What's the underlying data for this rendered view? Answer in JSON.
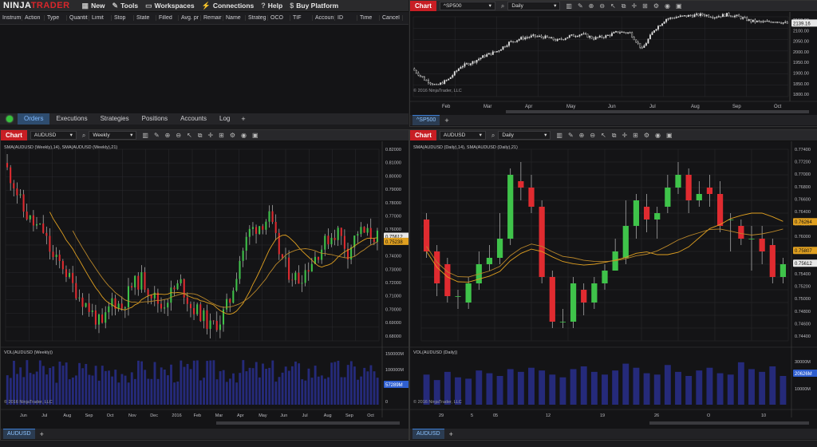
{
  "menu": {
    "logo_a": "NINJA",
    "logo_b": "TRADER",
    "items": [
      {
        "label": "New",
        "icon": "grid-icon"
      },
      {
        "label": "Tools",
        "icon": "wrench-icon"
      },
      {
        "label": "Workspaces",
        "icon": "folder-icon"
      },
      {
        "label": "Connections",
        "icon": "plug-icon"
      },
      {
        "label": "Help",
        "icon": "help-icon"
      },
      {
        "label": "Buy Platform",
        "icon": "dollar-icon"
      }
    ]
  },
  "orders": {
    "columns": [
      "Instrum",
      "Action",
      "Type",
      "Quantit",
      "Limit",
      "Stop",
      "State",
      "Filled",
      "Avg. pr",
      "Remair",
      "Name",
      "Strateg",
      "OCO",
      "TIF",
      "Accoun",
      "ID",
      "Time",
      "Cancel"
    ],
    "tabs": [
      "Orders",
      "Executions",
      "Strategies",
      "Positions",
      "Accounts",
      "Log"
    ],
    "active_tab": "Orders"
  },
  "chart_label": "Chart",
  "charts": [
    {
      "id": "spx",
      "instrument": "^SP500",
      "period": "Daily",
      "tab": "^SP500",
      "copyright": "© 2016 NinjaTrader, LLC",
      "price_labels": [
        "2150.00",
        "2100.00",
        "2050.00",
        "2000.00",
        "1950.00",
        "1900.00",
        "1850.00",
        "1800.00"
      ],
      "current_price": "2139.16",
      "x_labels": [
        "Feb",
        "Mar",
        "Apr",
        "May",
        "Jun",
        "Jul",
        "Aug",
        "Sep",
        "Oct"
      ]
    },
    {
      "id": "aud-weekly",
      "instrument": "AUDUSD",
      "period": "Weekly",
      "tab": "AUDUSD",
      "indicator_label": "SMA(AUDUSD (Weekly),14), SMA(AUDUSD (Weekly),21)",
      "volume_label": "VOL(AUDUSD (Weekly))",
      "copyright": "© 2016 NinjaTrader, LLC",
      "price_labels": [
        "0.82000",
        "0.81000",
        "0.80000",
        "0.79000",
        "0.78000",
        "0.77000",
        "0.76000",
        "0.75000",
        "0.74000",
        "0.73000",
        "0.72000",
        "0.71000",
        "0.70000",
        "0.69000",
        "0.68000"
      ],
      "current_price": "0.75612",
      "sma_price": "0.75238",
      "vol_labels": [
        "150000M",
        "100000M",
        "50000M",
        "0"
      ],
      "current_vol": "57289M",
      "x_labels": [
        "Jun",
        "Jul",
        "Aug",
        "Sep",
        "Oct",
        "Nov",
        "Dec",
        "2016",
        "Feb",
        "Mar",
        "Apr",
        "May",
        "Jun",
        "Jul",
        "Aug",
        "Sep",
        "Oct"
      ]
    },
    {
      "id": "aud-daily",
      "instrument": "AUDUSD",
      "period": "Daily",
      "indicator_label": "SMA(AUDUSD (Daily),14), SMA(AUDUSD (Daily),21)",
      "volume_label": "VOL(AUDUSD (Daily))",
      "copyright": "© 2016 NinjaTrader, LLC",
      "price_labels": [
        "0.77400",
        "0.77200",
        "0.77000",
        "0.76800",
        "0.76600",
        "0.76400",
        "0.76200",
        "0.76000",
        "0.75800",
        "0.75600",
        "0.75400",
        "0.75200",
        "0.75000",
        "0.74800",
        "0.74600",
        "0.74400"
      ],
      "current_price": "0.75612",
      "sma_fast_price": "0.76264",
      "sma_slow_price": "0.75807",
      "vol_labels": [
        "30000M",
        "20000M",
        "10000M"
      ],
      "current_vol": "20626M",
      "x_labels": [
        "29",
        "5",
        "05",
        "12",
        "19",
        "26",
        "O",
        "10"
      ]
    }
  ],
  "chart_data": [
    {
      "type": "candlestick",
      "name": "^SP500 Daily",
      "ylim": [
        1800,
        2160
      ],
      "path": [
        1930,
        1880,
        1850,
        1880,
        1940,
        1960,
        1990,
        2010,
        2050,
        2070,
        2080,
        2075,
        2060,
        2080,
        2090,
        2070,
        2080,
        2100,
        2095,
        2020,
        2110,
        2160,
        2170,
        2175,
        2180,
        2170,
        2180,
        2170,
        2150,
        2145,
        2150,
        2139
      ]
    },
    {
      "type": "candlestick",
      "name": "AUDUSD Weekly",
      "ylim": [
        0.68,
        0.82
      ],
      "path": [
        0.81,
        0.795,
        0.775,
        0.765,
        0.76,
        0.74,
        0.735,
        0.72,
        0.71,
        0.7,
        0.69,
        0.71,
        0.705,
        0.72,
        0.725,
        0.715,
        0.705,
        0.715,
        0.722,
        0.705,
        0.7,
        0.69,
        0.695,
        0.71,
        0.74,
        0.76,
        0.765,
        0.77,
        0.745,
        0.73,
        0.725,
        0.735,
        0.745,
        0.755,
        0.76,
        0.745,
        0.76,
        0.758,
        0.756
      ],
      "sma_fast_last": 0.7524,
      "sma_slow_last": 0.749
    },
    {
      "type": "candlestick",
      "name": "AUDUSD Daily",
      "ylim": [
        0.744,
        0.774
      ],
      "candles": [
        [
          0.763,
          0.758,
          0.764,
          0.757
        ],
        [
          0.758,
          0.753,
          0.759,
          0.751
        ],
        [
          0.756,
          0.751,
          0.757,
          0.75
        ],
        [
          0.751,
          0.751,
          0.752,
          0.749
        ],
        [
          0.75,
          0.753,
          0.754,
          0.749
        ],
        [
          0.753,
          0.756,
          0.758,
          0.752
        ],
        [
          0.756,
          0.757,
          0.759,
          0.755
        ],
        [
          0.757,
          0.76,
          0.764,
          0.756
        ],
        [
          0.76,
          0.77,
          0.771,
          0.759
        ],
        [
          0.769,
          0.768,
          0.772,
          0.766
        ],
        [
          0.768,
          0.765,
          0.77,
          0.764
        ],
        [
          0.765,
          0.754,
          0.766,
          0.753
        ],
        [
          0.754,
          0.747,
          0.755,
          0.746
        ],
        [
          0.747,
          0.747,
          0.749,
          0.746
        ],
        [
          0.747,
          0.753,
          0.754,
          0.746
        ],
        [
          0.752,
          0.75,
          0.753,
          0.748
        ],
        [
          0.75,
          0.753,
          0.754,
          0.749
        ],
        [
          0.753,
          0.755,
          0.756,
          0.752
        ],
        [
          0.755,
          0.758,
          0.76,
          0.755
        ],
        [
          0.757,
          0.762,
          0.766,
          0.756
        ],
        [
          0.762,
          0.766,
          0.767,
          0.76
        ],
        [
          0.765,
          0.763,
          0.767,
          0.761
        ],
        [
          0.763,
          0.764,
          0.765,
          0.76
        ],
        [
          0.765,
          0.768,
          0.77,
          0.764
        ],
        [
          0.768,
          0.77,
          0.772,
          0.767
        ],
        [
          0.77,
          0.766,
          0.771,
          0.764
        ],
        [
          0.766,
          0.767,
          0.769,
          0.765
        ],
        [
          0.768,
          0.767,
          0.77,
          0.765
        ],
        [
          0.767,
          0.762,
          0.769,
          0.761
        ],
        [
          0.763,
          0.763,
          0.764,
          0.758
        ],
        [
          0.762,
          0.76,
          0.763,
          0.759
        ],
        [
          0.76,
          0.76,
          0.762,
          0.755
        ],
        [
          0.76,
          0.758,
          0.762,
          0.756
        ],
        [
          0.759,
          0.754,
          0.76,
          0.753
        ],
        [
          0.754,
          0.756,
          0.757,
          0.753
        ]
      ],
      "volume": [
        22,
        18,
        24,
        20,
        19,
        25,
        23,
        21,
        26,
        24,
        27,
        25,
        22,
        20,
        26,
        28,
        24,
        22,
        25,
        30,
        27,
        23,
        22,
        29,
        24,
        21,
        25,
        27,
        23,
        22,
        31,
        26,
        24,
        28,
        21
      ]
    }
  ]
}
